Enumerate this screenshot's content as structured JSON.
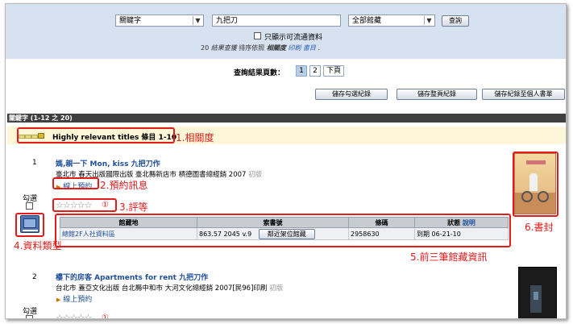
{
  "search": {
    "field_select": "關鍵字",
    "query": "九把刀",
    "library_select": "全部館藏",
    "search_button": "查詢",
    "available_only_label": "只顯示可流通資料",
    "summary_count": "20",
    "summary_results": "結果查獲",
    "summary_sort_prefix": "排序依照",
    "summary_sort": "相關度",
    "summary_print": "印刷",
    "summary_store": "書目"
  },
  "pager": {
    "label": "查詢結果頁數：",
    "pages": [
      "1",
      "2"
    ],
    "next": "下頁"
  },
  "actions": {
    "save_checked": "儲存勾選紀錄",
    "save_page": "儲存整頁紀錄",
    "save_to_shelf": "儲存紀錄至個人書單"
  },
  "result_header": "關鍵字 (1-12 之 20)",
  "relevance_label": "Highly relevant titles 條目 1-10",
  "items": [
    {
      "number": "1",
      "title": "媽,親一下 Mon, kiss 九把刀作",
      "publisher": "臺北市 春天出版國際出版 臺北縣新店市 槓德圖書總經銷 2007",
      "edition": "初版",
      "reserve": "線上預約",
      "select_label": "勾選",
      "rating_count": "①"
    },
    {
      "number": "2",
      "title": "樓下的房客 Apartments for rent 九把刀作",
      "publisher": "台北市 蓋亞文化出版 台北縣中和市 大河文化總經銷 2007[民96]印刷",
      "edition": "初版",
      "reserve": "線上預約",
      "select_label": "勾選",
      "rating_count": "①"
    }
  ],
  "holdings": {
    "headers": [
      "館藏地",
      "索書號",
      "條碼",
      "狀態"
    ],
    "status_help": "說明",
    "row": {
      "location": "總館2F人社資料區",
      "call_number": "863.57 2045 v.9",
      "shelf_button": "鄰近架位館藏",
      "barcode": "2958630",
      "status": "到期 06-21-10"
    }
  },
  "annotations": {
    "relevance": "1.相關度",
    "reserve": "2.預約訊息",
    "rating": "3.評等",
    "material_type": "4.資料類型",
    "holdings": "5.前三筆館藏資訊",
    "cover": "6.書封"
  },
  "colors": {
    "annotation_red": "#e31b1b",
    "link_blue": "#1f4f9a",
    "panel_blue": "#d6e2f0",
    "header_dark": "#3f3f3f"
  }
}
